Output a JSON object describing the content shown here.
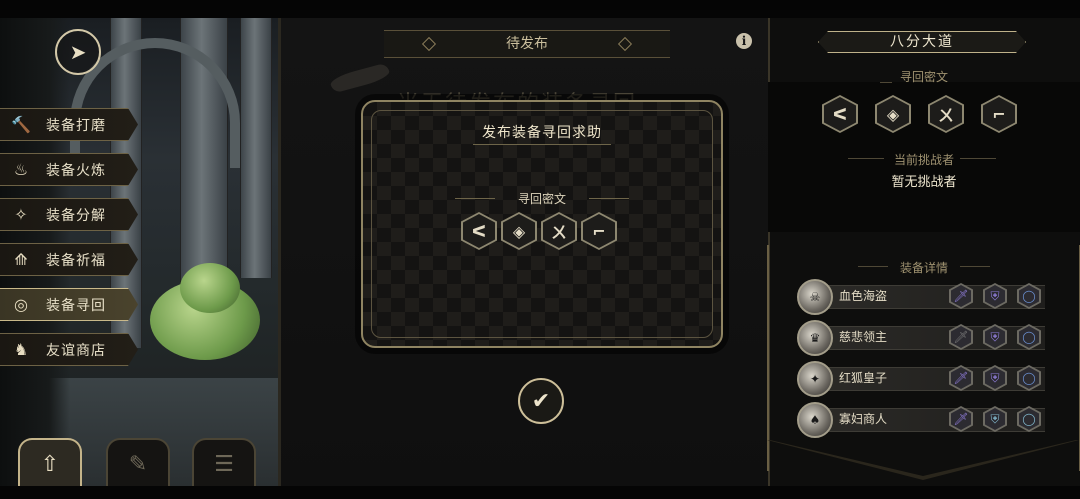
{
  "header": {
    "tab_title": "待发布",
    "info_icon": "i",
    "background_text": "当无待发布的装备寻回"
  },
  "sidebar": {
    "back_icon": "back-arrow-icon",
    "items": [
      {
        "label": "装备打磨",
        "icon": "hammer-icon",
        "glyph": "🔨",
        "active": false
      },
      {
        "label": "装备火炼",
        "icon": "flame-icon",
        "glyph": "♨",
        "active": false
      },
      {
        "label": "装备分解",
        "icon": "swirl-icon",
        "glyph": "✧",
        "active": false
      },
      {
        "label": "装备祈福",
        "icon": "hands-icon",
        "glyph": "⟰",
        "active": false
      },
      {
        "label": "装备寻回",
        "icon": "target-icon",
        "glyph": "◎",
        "active": true
      },
      {
        "label": "友谊商店",
        "icon": "fox-icon",
        "glyph": "♞",
        "active": false
      }
    ],
    "bottom_buttons": [
      {
        "name": "upload-tab-button",
        "glyph": "⇧",
        "active": true
      },
      {
        "name": "feather-tab-button",
        "glyph": "✎",
        "active": false
      },
      {
        "name": "list-tab-button",
        "glyph": "☰",
        "active": false
      }
    ]
  },
  "modal": {
    "title": "发布装备寻回求助",
    "cipher_label": "寻回密文",
    "cipher_glyphs": [
      "ᐸ",
      "◈",
      "ㄨ",
      "⌐"
    ],
    "confirm_glyph": "✔"
  },
  "right_panel": {
    "title": "八分大道",
    "cipher_label": "寻回密文",
    "cipher_glyphs": [
      "ᐸ",
      "◈",
      "ㄨ",
      "⌐"
    ],
    "challenger_label": "当前挑战者",
    "challenger_value": "暂无挑战者",
    "equipment_label": "装备详情",
    "equipment": [
      {
        "name": "血色海盗",
        "avatar": "☠",
        "slots": [
          "🗡",
          "⛨",
          "◯"
        ],
        "colors": [
          "#8d7bd6",
          "#8d7bd6",
          "#6a8fd0"
        ]
      },
      {
        "name": "慈悲领主",
        "avatar": "♛",
        "slots": [
          "🗡",
          "⛨",
          "◯"
        ],
        "colors": [
          "#777777",
          "#8d7bd6",
          "#6a8fd0"
        ]
      },
      {
        "name": "红狐皇子",
        "avatar": "✦",
        "slots": [
          "🗡",
          "⛨",
          "◯"
        ],
        "colors": [
          "#8d7bd6",
          "#8d7bd6",
          "#6a8fd0"
        ]
      },
      {
        "name": "寡妇商人",
        "avatar": "♠",
        "slots": [
          "🗡",
          "⛨",
          "◯"
        ],
        "colors": [
          "#8d7bd6",
          "#7fb4c9",
          "#7fb4c9"
        ]
      }
    ]
  }
}
